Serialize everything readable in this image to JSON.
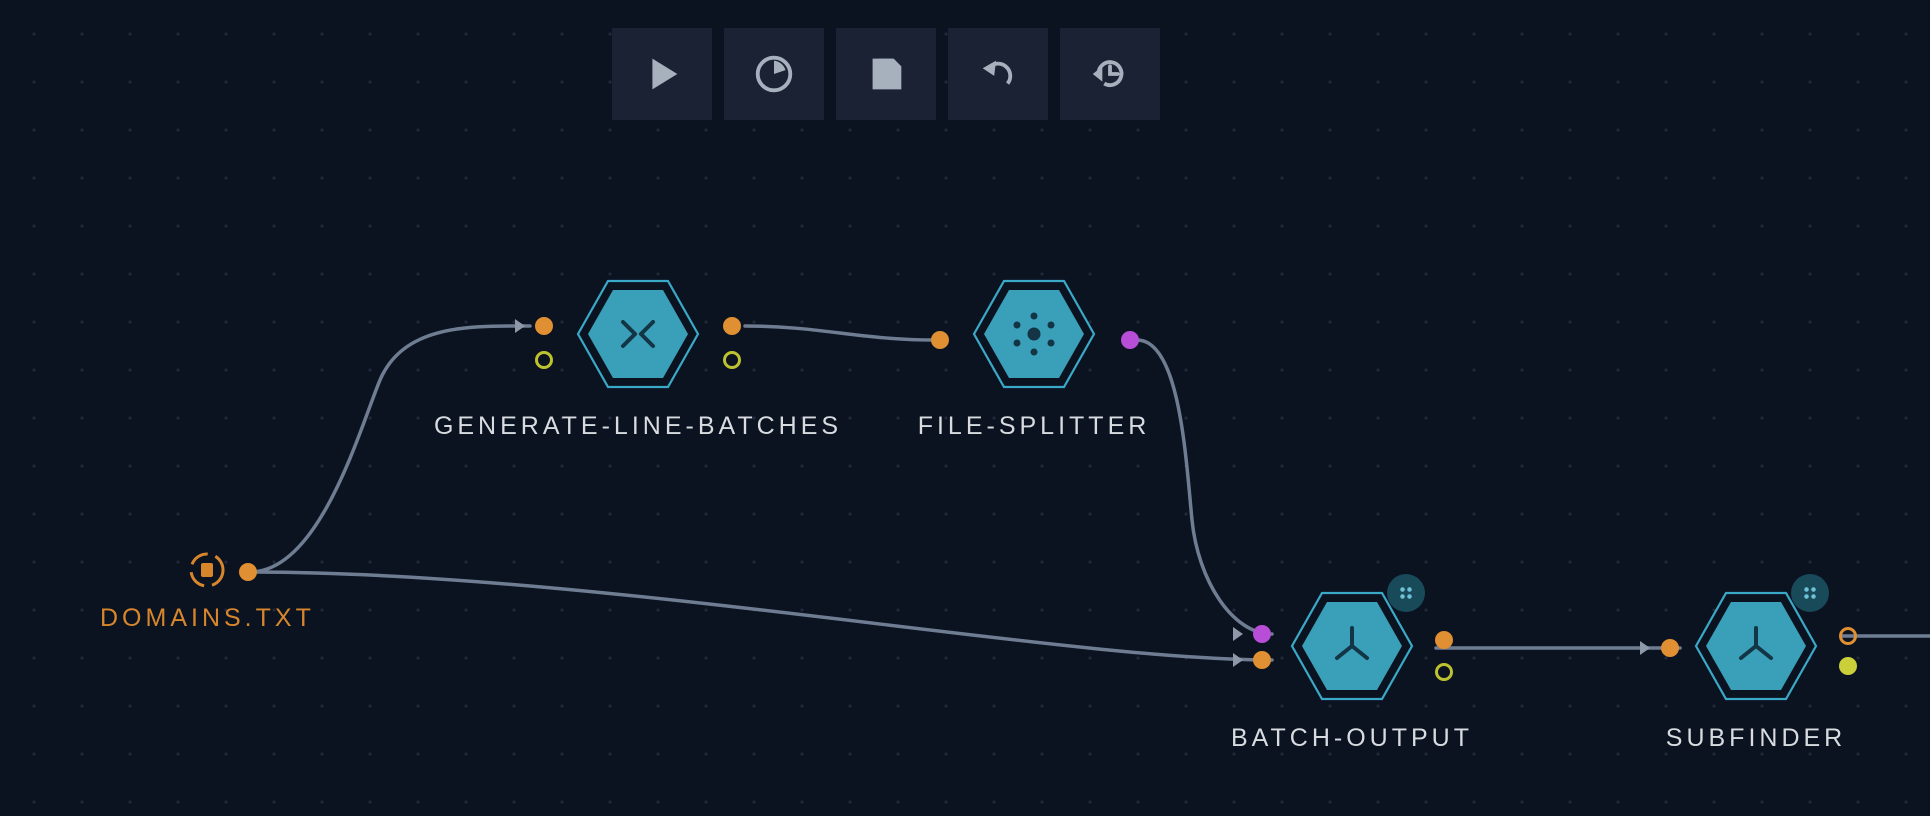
{
  "toolbar": [
    "play",
    "clock",
    "save",
    "undo",
    "history"
  ],
  "nodes": {
    "file": {
      "label": "DOMAINS.TXT"
    },
    "genlines": {
      "label": "GENERATE-LINE-BATCHES"
    },
    "filesplit": {
      "label": "FILE-SPLITTER"
    },
    "batchout": {
      "label": "BATCH-OUTPUT"
    },
    "subfinder": {
      "label": "SUBFINDER"
    }
  }
}
